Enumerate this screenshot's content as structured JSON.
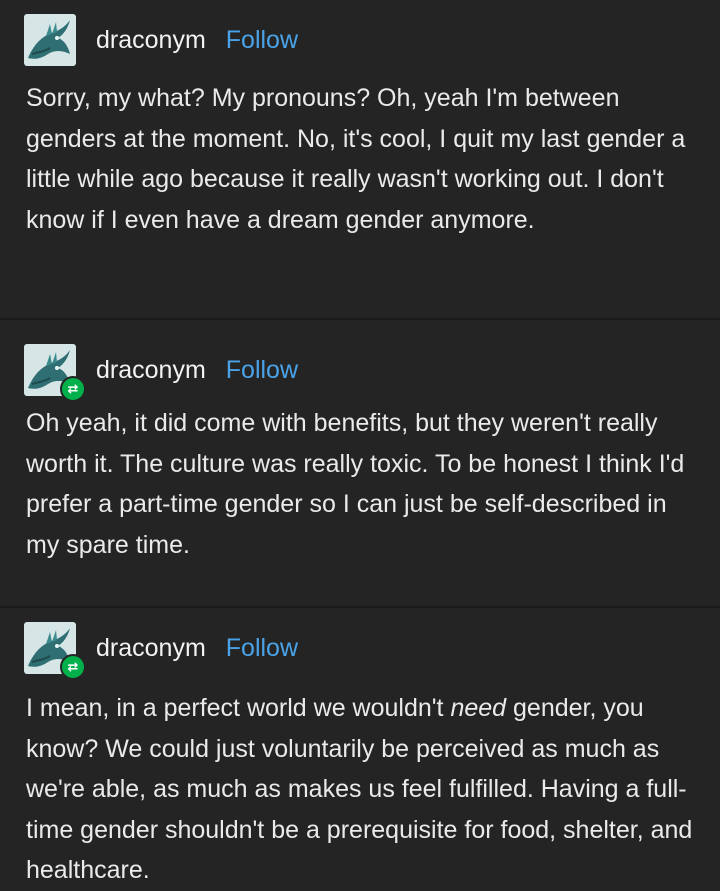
{
  "posts": [
    {
      "username": "draconym",
      "follow_label": "Follow",
      "reblogged": false,
      "avatar": "dragon-avatar-icon",
      "text": "Sorry, my what? My pronouns? Oh, yeah I'm between genders at the moment. No, it's cool, I quit my last gender a little while ago because it really wasn't working out. I don't know if I even have a dream gender anymore."
    },
    {
      "username": "draconym",
      "follow_label": "Follow",
      "reblogged": true,
      "avatar": "dragon-avatar-icon",
      "text": "Oh yeah, it did come with benefits, but they weren't really worth it. The culture was really toxic. To be honest I think I'd prefer a part-time gender so I can just be self-described in my spare time."
    },
    {
      "username": "draconym",
      "follow_label": "Follow",
      "reblogged": true,
      "avatar": "dragon-avatar-icon",
      "text_before": "I mean, in a perfect world we wouldn't ",
      "text_emphasis": "need",
      "text_after": " gender, you know? We could just voluntarily be perceived as much as we're able, as much as makes us feel fulfilled. Having a full-time gender shouldn't be a prerequisite for food, shelter, and healthcare."
    }
  ],
  "colors": {
    "background": "#242424",
    "follow": "#4aa3e8",
    "reblog_badge": "#00b04a",
    "text": "#eaeaea"
  },
  "icons": {
    "reblog": "reblog-icon",
    "reblog_glyph": "⇄"
  }
}
